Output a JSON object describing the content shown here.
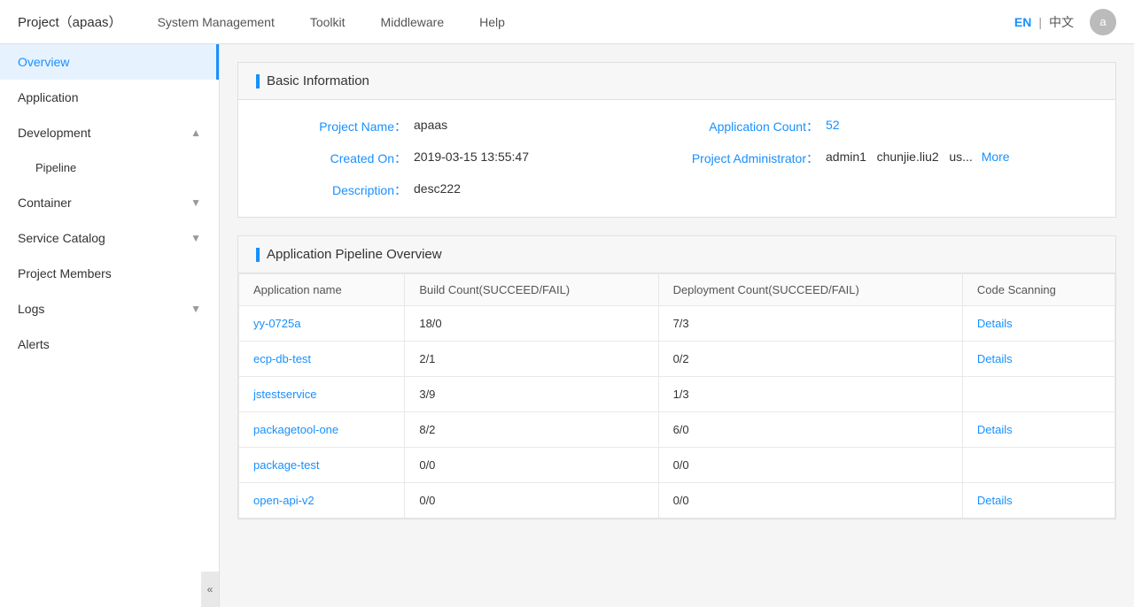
{
  "topNav": {
    "brand": "Project（apaas）",
    "items": [
      "System Management",
      "Toolkit",
      "Middleware",
      "Help"
    ],
    "langEN": "EN",
    "langSeparator": "|",
    "langZH": "中文",
    "avatarLabel": "a"
  },
  "sidebar": {
    "items": [
      {
        "id": "overview",
        "label": "Overview",
        "active": true,
        "hasChevron": false,
        "subItems": []
      },
      {
        "id": "application",
        "label": "Application",
        "active": false,
        "hasChevron": false,
        "subItems": []
      },
      {
        "id": "development",
        "label": "Development",
        "active": false,
        "hasChevron": true,
        "expanded": true,
        "subItems": [
          {
            "id": "pipeline",
            "label": "Pipeline"
          }
        ]
      },
      {
        "id": "container",
        "label": "Container",
        "active": false,
        "hasChevron": true,
        "expanded": false,
        "subItems": []
      },
      {
        "id": "service-catalog",
        "label": "Service Catalog",
        "active": false,
        "hasChevron": true,
        "expanded": false,
        "subItems": []
      },
      {
        "id": "project-members",
        "label": "Project Members",
        "active": false,
        "hasChevron": false,
        "subItems": []
      },
      {
        "id": "logs",
        "label": "Logs",
        "active": false,
        "hasChevron": true,
        "expanded": false,
        "subItems": []
      },
      {
        "id": "alerts",
        "label": "Alerts",
        "active": false,
        "hasChevron": false,
        "subItems": []
      }
    ],
    "collapseIcon": "«"
  },
  "basicInfo": {
    "sectionTitle": "Basic Information",
    "fields": [
      {
        "label": "Project Name：",
        "value": "apaas"
      },
      {
        "label": "Application Count：",
        "value": "52"
      },
      {
        "label": "Created On：",
        "value": "2019-03-15 13:55:47"
      },
      {
        "label": "Project Administrator：",
        "admins": [
          "admin1",
          "chunjie.liu2",
          "us..."
        ],
        "moreLabel": "More"
      },
      {
        "label": "Description：",
        "value": "desc222"
      }
    ]
  },
  "pipelineOverview": {
    "sectionTitle": "Application Pipeline Overview",
    "columns": [
      "Application name",
      "Build Count(SUCCEED/FAIL)",
      "Deployment Count(SUCCEED/FAIL)",
      "Code Scanning"
    ],
    "rows": [
      {
        "name": "yy-0725a",
        "buildCount": "18/0",
        "deployCount": "7/3",
        "codeScanning": "Details"
      },
      {
        "name": "ecp-db-test",
        "buildCount": "2/1",
        "deployCount": "0/2",
        "codeScanning": "Details"
      },
      {
        "name": "jstestservice",
        "buildCount": "3/9",
        "deployCount": "1/3",
        "codeScanning": ""
      },
      {
        "name": "packagetool-one",
        "buildCount": "8/2",
        "deployCount": "6/0",
        "codeScanning": "Details"
      },
      {
        "name": "package-test",
        "buildCount": "0/0",
        "deployCount": "0/0",
        "codeScanning": ""
      },
      {
        "name": "open-api-v2",
        "buildCount": "0/0",
        "deployCount": "0/0",
        "codeScanning": "Details"
      }
    ]
  }
}
